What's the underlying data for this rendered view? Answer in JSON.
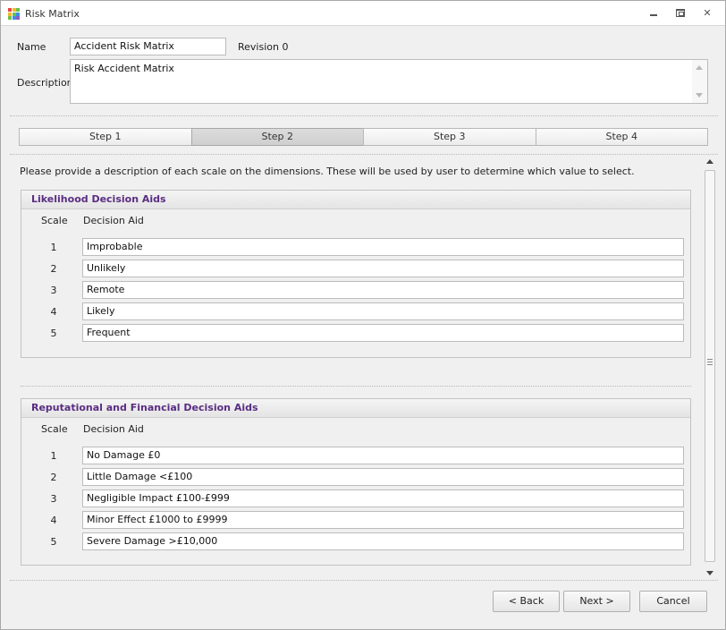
{
  "window": {
    "title": "Risk Matrix"
  },
  "header": {
    "name_label": "Name",
    "name_value": "Accident Risk Matrix",
    "revision": "Revision 0",
    "description_label": "Description",
    "description_value": "Risk Accident Matrix"
  },
  "tabs": [
    {
      "label": "Step 1",
      "active": false
    },
    {
      "label": "Step 2",
      "active": true
    },
    {
      "label": "Step 3",
      "active": false
    },
    {
      "label": "Step 4",
      "active": false
    }
  ],
  "instruction": "Please provide a description of each scale on the dimensions. These will be used by user to determine which value to select.",
  "likelihood": {
    "title": "Likelihood Decision Aids",
    "scale_header": "Scale",
    "aid_header": "Decision Aid",
    "rows": [
      {
        "scale": "1",
        "aid": "Improbable"
      },
      {
        "scale": "2",
        "aid": "Unlikely"
      },
      {
        "scale": "3",
        "aid": "Remote"
      },
      {
        "scale": "4",
        "aid": "Likely"
      },
      {
        "scale": "5",
        "aid": "Frequent"
      }
    ]
  },
  "reputational": {
    "title": "Reputational and Financial Decision Aids",
    "scale_header": "Scale",
    "aid_header": "Decision Aid",
    "rows": [
      {
        "scale": "1",
        "aid": "No Damage £0"
      },
      {
        "scale": "2",
        "aid": "Little Damage <£100"
      },
      {
        "scale": "3",
        "aid": "Negligible Impact £100-£999"
      },
      {
        "scale": "4",
        "aid": "Minor Effect £1000 to £9999"
      },
      {
        "scale": "5",
        "aid": "Severe Damage >£10,000"
      }
    ]
  },
  "buttons": {
    "back": "< Back",
    "next": "Next >",
    "cancel": "Cancel"
  },
  "colors": {
    "group_title": "#5a2d82",
    "active_tab": "#d4d4d4"
  },
  "icons": {
    "app": "grid-icon",
    "minimize": "minimize-icon",
    "maximize": "maximize-icon",
    "close": "close-icon"
  }
}
